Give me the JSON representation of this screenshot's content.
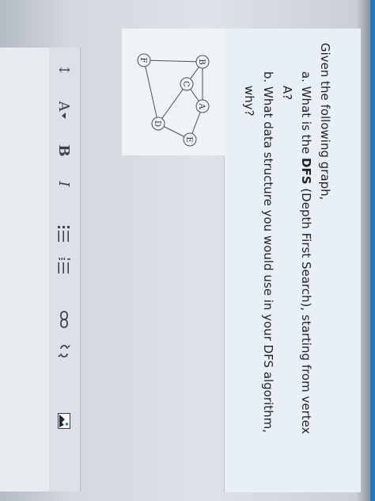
{
  "question": {
    "intro": "Given the following graph,",
    "part_a_line1_prefix": "a. What is the ",
    "part_a_line1_strong": "DFS",
    "part_a_line1_suffix": " (Depth First Search), starting from vertex",
    "part_a_line2": "A?",
    "part_b_line1": "b. What data structure you would use in your DFS algorithm,",
    "part_b_line2": "why?"
  },
  "graph": {
    "nodes": [
      "A",
      "B",
      "C",
      "D",
      "E",
      "F"
    ]
  },
  "toolbar": {
    "paragraph_label": "↕",
    "font_label": "A",
    "bold_label": "B",
    "italic_label": "I",
    "unordered_list_label": "≔",
    "ordered_list_label": "≔",
    "link_icon": "link-icon",
    "unlink_icon": "unlink-icon",
    "image_icon": "image-icon"
  },
  "colors": {
    "accent": "#2b78b9",
    "panel": "#e9f0f5",
    "text": "#1f2226"
  }
}
